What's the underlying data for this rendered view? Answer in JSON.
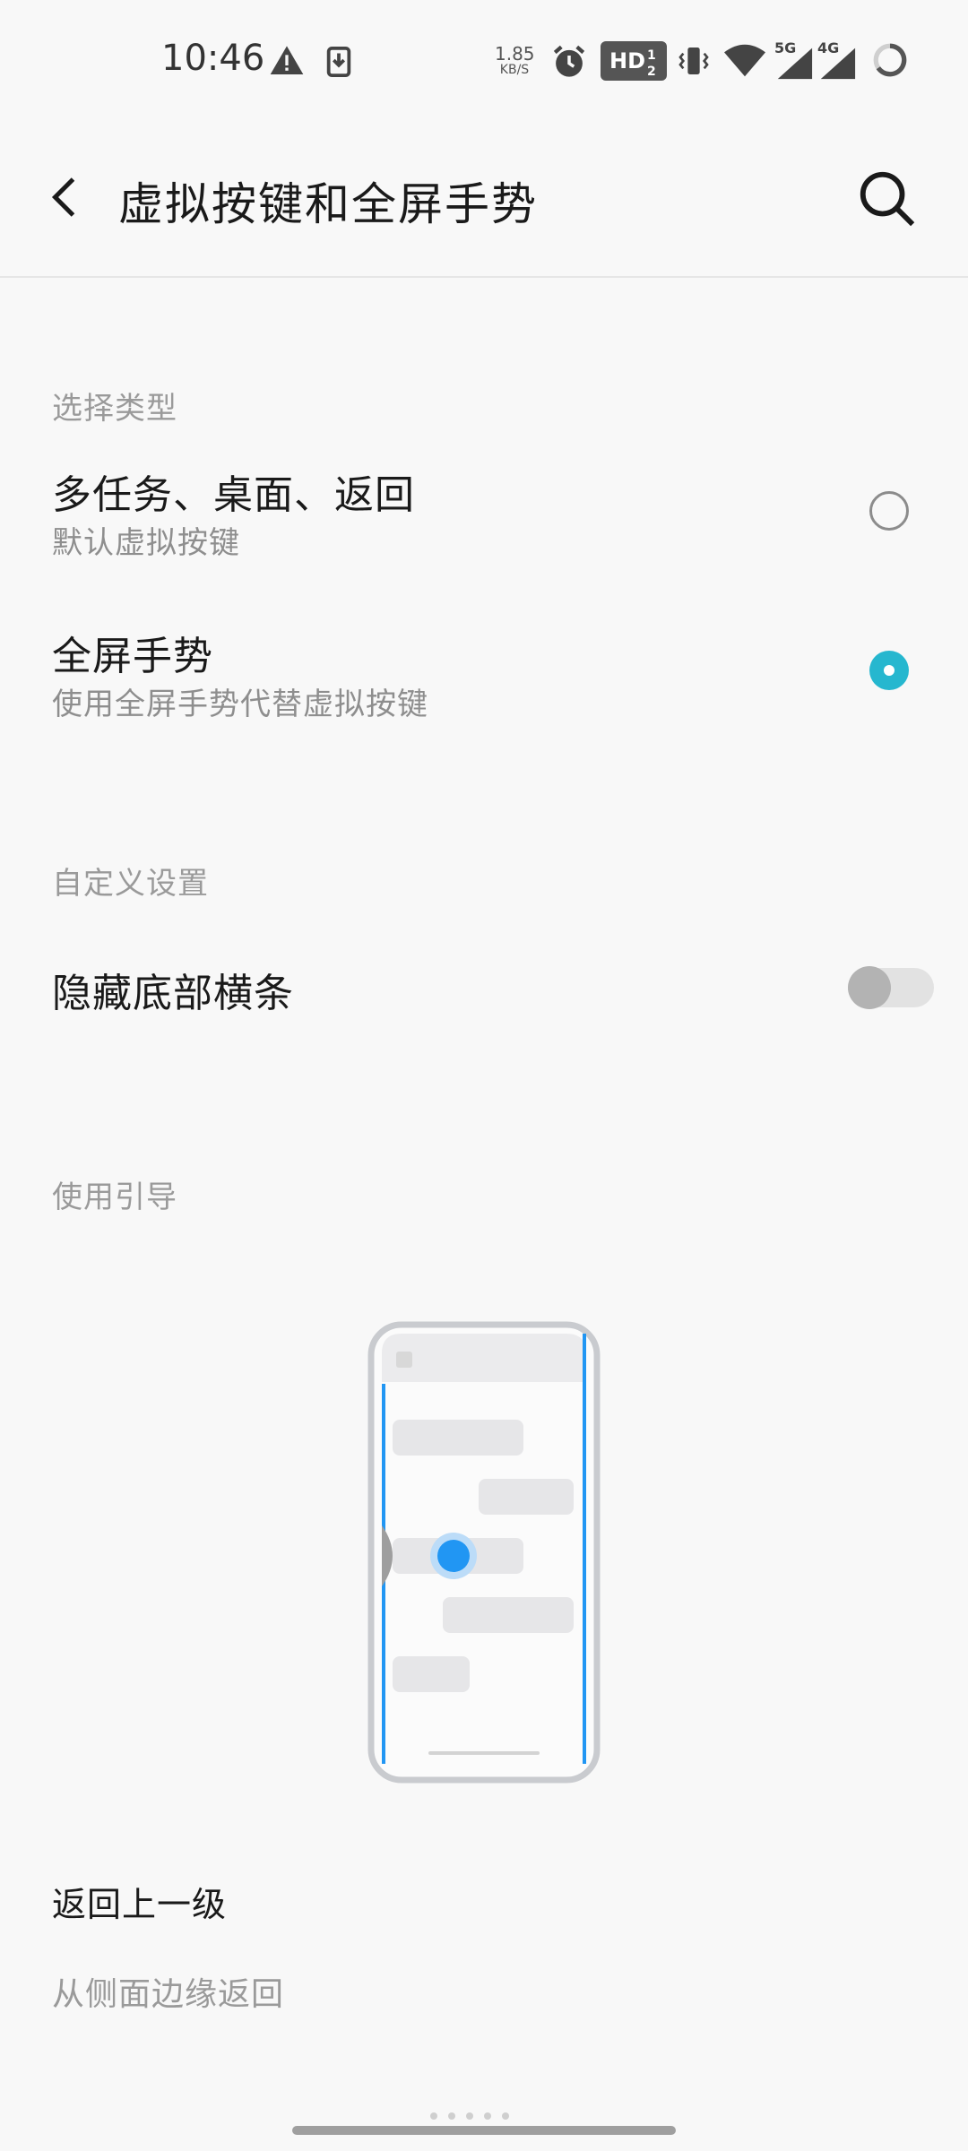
{
  "status_bar": {
    "time": "10:46",
    "net_speed_value": "1.85",
    "net_speed_unit": "KB/S",
    "hd_label": "HD",
    "signal_5g": "5G",
    "signal_4g": "4G",
    "icons": [
      "warning-icon",
      "download-icon",
      "alarm-icon",
      "hd-voice-icon",
      "vibrate-icon",
      "wifi-icon",
      "signal-5g-icon",
      "signal-4g-icon",
      "battery-ring-icon"
    ]
  },
  "app_bar": {
    "title": "虚拟按键和全屏手势",
    "back_icon": "back-arrow-icon",
    "search_icon": "search-icon"
  },
  "sections": {
    "select_type_label": "选择类型",
    "custom_settings_label": "自定义设置",
    "guide_label": "使用引导"
  },
  "options": [
    {
      "title": "多任务、桌面、返回",
      "subtitle": "默认虚拟按键",
      "selected": false
    },
    {
      "title": "全屏手势",
      "subtitle": "使用全屏手势代替虚拟按键",
      "selected": true
    }
  ],
  "toggle": {
    "label": "隐藏底部横条",
    "on": false
  },
  "guide": {
    "title": "返回上一级",
    "description": "从侧面边缘返回"
  },
  "colors": {
    "accent": "#26b7cf",
    "gesture_blue": "#2196f3",
    "background": "#f8f8f8"
  }
}
